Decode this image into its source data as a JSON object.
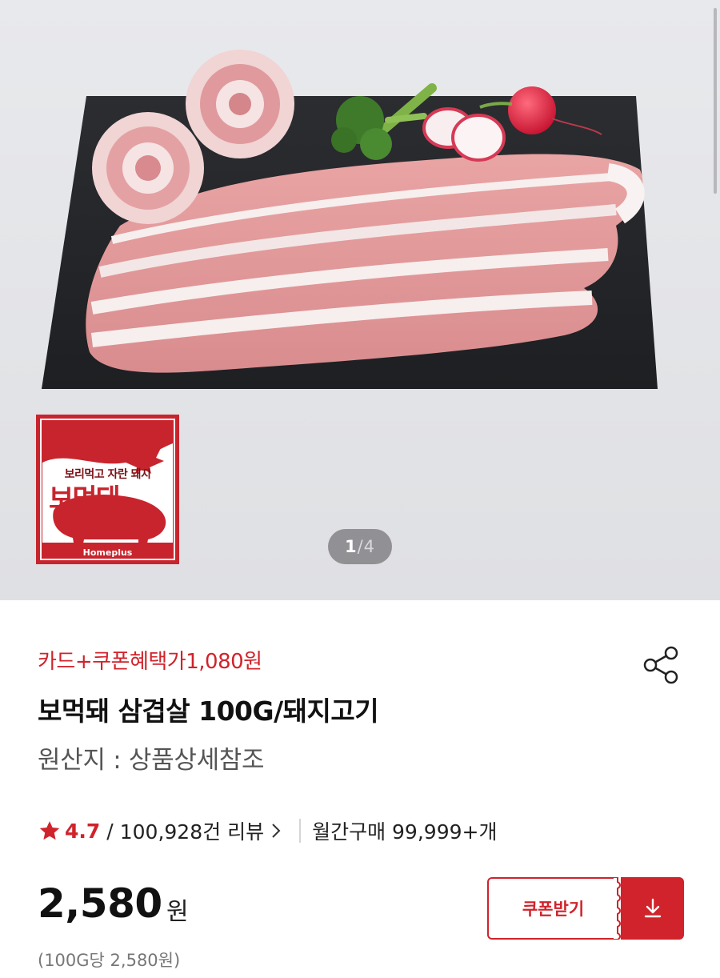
{
  "gallery": {
    "current": "1",
    "separator": "/",
    "total": "4",
    "scroll_color": "#b7b8bb"
  },
  "brand_badge": {
    "tagline": "보리먹고 자란 돼지",
    "name": "보먹돼",
    "store": "Homeplus",
    "color": "#c8242d"
  },
  "product": {
    "benefit_price_label": "카드+쿠폰혜택가1,080원",
    "title": "보먹돼 삼겹살 100G/돼지고기",
    "origin": "원산지 : 상품상세참조",
    "rating": "4.7",
    "rating_slash": "/",
    "review_count": "100,928건 리뷰",
    "monthly_purchase": "월간구매 99,999+개",
    "price": "2,580",
    "price_unit": "원",
    "unit_price": "(100G당 2,580원)"
  },
  "actions": {
    "coupon_label": "쿠폰받기",
    "share_icon": "share-icon",
    "download_icon": "download-icon"
  },
  "colors": {
    "accent": "#d0232b",
    "text": "#111111",
    "muted": "#777777"
  }
}
